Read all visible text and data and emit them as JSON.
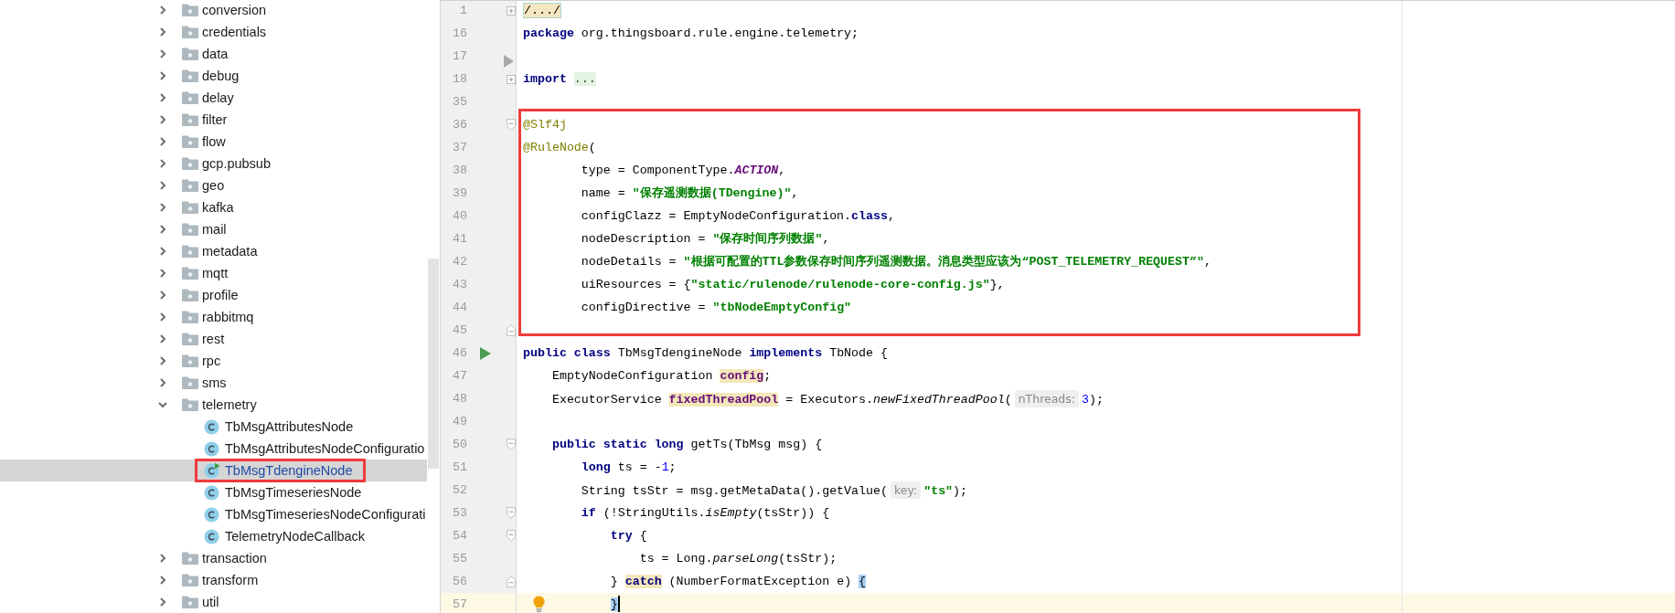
{
  "project_tree": {
    "items": [
      {
        "label": "conversion",
        "kind": "folder",
        "expanded": false,
        "selected": false,
        "framed": false
      },
      {
        "label": "credentials",
        "kind": "folder",
        "expanded": false,
        "selected": false,
        "framed": false
      },
      {
        "label": "data",
        "kind": "folder",
        "expanded": false,
        "selected": false,
        "framed": false
      },
      {
        "label": "debug",
        "kind": "folder",
        "expanded": false,
        "selected": false,
        "framed": false
      },
      {
        "label": "delay",
        "kind": "folder",
        "expanded": false,
        "selected": false,
        "framed": false
      },
      {
        "label": "filter",
        "kind": "folder",
        "expanded": false,
        "selected": false,
        "framed": false
      },
      {
        "label": "flow",
        "kind": "folder",
        "expanded": false,
        "selected": false,
        "framed": false
      },
      {
        "label": "gcp.pubsub",
        "kind": "folder",
        "expanded": false,
        "selected": false,
        "framed": false
      },
      {
        "label": "geo",
        "kind": "folder",
        "expanded": false,
        "selected": false,
        "framed": false
      },
      {
        "label": "kafka",
        "kind": "folder",
        "expanded": false,
        "selected": false,
        "framed": false
      },
      {
        "label": "mail",
        "kind": "folder",
        "expanded": false,
        "selected": false,
        "framed": false
      },
      {
        "label": "metadata",
        "kind": "folder",
        "expanded": false,
        "selected": false,
        "framed": false
      },
      {
        "label": "mqtt",
        "kind": "folder",
        "expanded": false,
        "selected": false,
        "framed": false
      },
      {
        "label": "profile",
        "kind": "folder",
        "expanded": false,
        "selected": false,
        "framed": false
      },
      {
        "label": "rabbitmq",
        "kind": "folder",
        "expanded": false,
        "selected": false,
        "framed": false
      },
      {
        "label": "rest",
        "kind": "folder",
        "expanded": false,
        "selected": false,
        "framed": false
      },
      {
        "label": "rpc",
        "kind": "folder",
        "expanded": false,
        "selected": false,
        "framed": false
      },
      {
        "label": "sms",
        "kind": "folder",
        "expanded": false,
        "selected": false,
        "framed": false
      },
      {
        "label": "telemetry",
        "kind": "folder",
        "expanded": true,
        "selected": false,
        "framed": false,
        "children": [
          {
            "label": "TbMsgAttributesNode",
            "kind": "class",
            "runnable": false,
            "selected": false,
            "framed": false
          },
          {
            "label": "TbMsgAttributesNodeConfiguratio",
            "kind": "class",
            "runnable": false,
            "selected": false,
            "framed": false
          },
          {
            "label": "TbMsgTdengineNode",
            "kind": "class",
            "runnable": true,
            "selected": true,
            "framed": true
          },
          {
            "label": "TbMsgTimeseriesNode",
            "kind": "class",
            "runnable": false,
            "selected": false,
            "framed": false
          },
          {
            "label": "TbMsgTimeseriesNodeConfigurati",
            "kind": "class",
            "runnable": false,
            "selected": false,
            "framed": false
          },
          {
            "label": "TelemetryNodeCallback",
            "kind": "class",
            "runnable": false,
            "selected": false,
            "framed": false
          }
        ]
      },
      {
        "label": "transaction",
        "kind": "folder",
        "expanded": false,
        "selected": false,
        "framed": false
      },
      {
        "label": "transform",
        "kind": "folder",
        "expanded": false,
        "selected": false,
        "framed": false
      },
      {
        "label": "util",
        "kind": "folder",
        "expanded": false,
        "selected": false,
        "framed": false
      }
    ]
  },
  "editor": {
    "sections": [
      {
        "framed": false,
        "lines": [
          {
            "number": "1",
            "marker": {
              "kind": "expand"
            },
            "current": false,
            "tokens": [
              {
                "text": "/.../",
                "kind": "fold"
              }
            ]
          },
          {
            "number": "16",
            "current": false,
            "tokens": [
              {
                "text": "package",
                "kind": "keyword"
              },
              {
                "text": " org.thingsboard.rule.engine.telemetry;",
                "kind": "plain"
              }
            ]
          },
          {
            "number": "17",
            "marker": {
              "kind": "arrow"
            },
            "current": false
          },
          {
            "number": "18",
            "marker": {
              "kind": "expand"
            },
            "current": false,
            "tokens": [
              {
                "text": "import ",
                "kind": "keyword"
              },
              {
                "text": "...",
                "kind": "ellipsis"
              }
            ]
          },
          {
            "number": "35",
            "current": false
          }
        ]
      },
      {
        "framed": true,
        "lines": [
          {
            "number": "36",
            "marker": {
              "kind": "collapse"
            },
            "current": false,
            "tokens": [
              {
                "text": "@Slf4j",
                "kind": "annotation"
              }
            ]
          },
          {
            "number": "37",
            "current": false,
            "tokens": [
              {
                "text": "@RuleNode",
                "kind": "annotation"
              },
              {
                "text": "(",
                "kind": "plain"
              }
            ]
          },
          {
            "number": "38",
            "current": false,
            "tokens": [
              {
                "text": "        type = ComponentType.",
                "kind": "plain"
              },
              {
                "text": "ACTION",
                "kind": "constant"
              },
              {
                "text": ",",
                "kind": "plain"
              }
            ]
          },
          {
            "number": "39",
            "current": false,
            "tokens": [
              {
                "text": "        name = ",
                "kind": "plain"
              },
              {
                "text": "\"保存遥测数据(TDengine)\"",
                "kind": "string"
              },
              {
                "text": ",",
                "kind": "plain"
              }
            ]
          },
          {
            "number": "40",
            "current": false,
            "tokens": [
              {
                "text": "        configClazz = EmptyNodeConfiguration.",
                "kind": "plain"
              },
              {
                "text": "class",
                "kind": "keyword"
              },
              {
                "text": ",",
                "kind": "plain"
              }
            ]
          },
          {
            "number": "41",
            "current": false,
            "tokens": [
              {
                "text": "        nodeDescription = ",
                "kind": "plain"
              },
              {
                "text": "\"保存时间序列数据\"",
                "kind": "string"
              },
              {
                "text": ",",
                "kind": "plain"
              }
            ]
          },
          {
            "number": "42",
            "current": false,
            "tokens": [
              {
                "text": "        nodeDetails = ",
                "kind": "plain"
              },
              {
                "text": "\"根据可配置的TTL参数保存时间序列遥测数据。消息类型应该为“POST_TELEMETRY_REQUEST”\"",
                "kind": "string"
              },
              {
                "text": ",",
                "kind": "plain"
              }
            ]
          },
          {
            "number": "43",
            "current": false,
            "tokens": [
              {
                "text": "        uiResources = {",
                "kind": "plain"
              },
              {
                "text": "\"static/rulenode/rulenode-core-config.js\"",
                "kind": "string"
              },
              {
                "text": "},",
                "kind": "plain"
              }
            ]
          },
          {
            "number": "44",
            "current": false,
            "tokens": [
              {
                "text": "        configDirective = ",
                "kind": "plain"
              },
              {
                "text": "\"tbNodeEmptyConfig\"",
                "kind": "string"
              }
            ]
          },
          {
            "number": "45",
            "marker": {
              "kind": "fold-end"
            },
            "current": false
          }
        ]
      },
      {
        "framed": false,
        "lines": [
          {
            "number": "46",
            "marker": {
              "kind": "run"
            },
            "current": false,
            "tokens": [
              {
                "text": "public class",
                "kind": "keyword"
              },
              {
                "text": " TbMsgTdengineNode ",
                "kind": "plain"
              },
              {
                "text": "implements",
                "kind": "keyword"
              },
              {
                "text": " TbNode {",
                "kind": "plain"
              }
            ]
          },
          {
            "number": "47",
            "current": false,
            "tokens": [
              {
                "text": "    EmptyNodeConfiguration ",
                "kind": "plain"
              },
              {
                "text": "config",
                "kind": "field",
                "highlight": {
                  "kind": "usage"
                }
              },
              {
                "text": ";",
                "kind": "plain"
              }
            ]
          },
          {
            "number": "48",
            "current": false,
            "tokens": [
              {
                "text": "    ExecutorService ",
                "kind": "plain"
              },
              {
                "text": "fixedThreadPool",
                "kind": "field",
                "highlight": {
                  "kind": "usage"
                }
              },
              {
                "text": " = Executors.",
                "kind": "plain"
              },
              {
                "text": "newFixedThreadPool",
                "kind": "italic"
              },
              {
                "text": "(",
                "kind": "plain"
              },
              {
                "text": "nThreads:",
                "kind": "hint"
              },
              {
                "text": "3",
                "kind": "number"
              },
              {
                "text": ");",
                "kind": "plain"
              }
            ]
          },
          {
            "number": "49",
            "current": false
          },
          {
            "number": "50",
            "marker": {
              "kind": "collapse"
            },
            "current": false,
            "tokens": [
              {
                "text": "    public static long",
                "kind": "keyword"
              },
              {
                "text": " getTs(TbMsg msg) {",
                "kind": "plain"
              }
            ]
          },
          {
            "number": "51",
            "current": false,
            "tokens": [
              {
                "text": "        long",
                "kind": "keyword"
              },
              {
                "text": " ts = -",
                "kind": "plain"
              },
              {
                "text": "1",
                "kind": "number"
              },
              {
                "text": ";",
                "kind": "plain"
              }
            ]
          },
          {
            "number": "52",
            "current": false,
            "tokens": [
              {
                "text": "        String tsStr = msg.getMetaData().getValue(",
                "kind": "plain"
              },
              {
                "text": "key:",
                "kind": "hint"
              },
              {
                "text": "\"ts\"",
                "kind": "string"
              },
              {
                "text": ");",
                "kind": "plain"
              }
            ]
          },
          {
            "number": "53",
            "marker": {
              "kind": "collapse"
            },
            "current": false,
            "tokens": [
              {
                "text": "        if",
                "kind": "keyword"
              },
              {
                "text": " (!StringUtils.",
                "kind": "plain"
              },
              {
                "text": "isEmpty",
                "kind": "italic"
              },
              {
                "text": "(tsStr)) {",
                "kind": "plain"
              }
            ]
          },
          {
            "number": "54",
            "marker": {
              "kind": "collapse"
            },
            "current": false,
            "tokens": [
              {
                "text": "            try",
                "kind": "keyword"
              },
              {
                "text": " {",
                "kind": "plain"
              }
            ]
          },
          {
            "number": "55",
            "current": false,
            "tokens": [
              {
                "text": "                ts = Long.",
                "kind": "plain"
              },
              {
                "text": "parseLong",
                "kind": "italic"
              },
              {
                "text": "(tsStr);",
                "kind": "plain"
              }
            ]
          },
          {
            "number": "56",
            "marker": {
              "kind": "fold-end"
            },
            "current": false,
            "tokens": [
              {
                "text": "            } ",
                "kind": "plain"
              },
              {
                "text": "catch",
                "kind": "keyword",
                "highlight": {
                  "kind": "usage"
                }
              },
              {
                "text": " (NumberFormatException e) ",
                "kind": "plain"
              },
              {
                "text": "{",
                "kind": "plain",
                "highlight": {
                  "kind": "brace"
                }
              }
            ]
          },
          {
            "number": "57",
            "marker": {
              "kind": "bulb"
            },
            "current": true,
            "tokens": [
              {
                "text": "            }",
                "kind": "plain",
                "highlight": {
                  "kind": "brace"
                }
              }
            ]
          }
        ]
      }
    ]
  }
}
